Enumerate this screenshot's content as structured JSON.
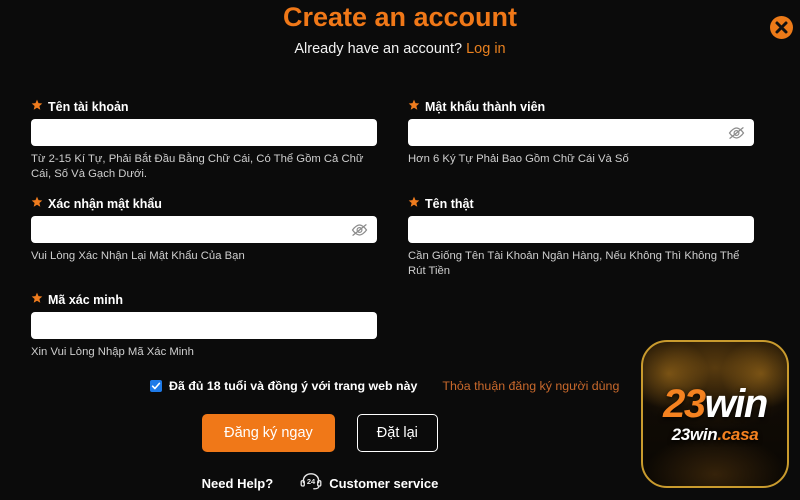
{
  "header": {
    "title": "Create an account",
    "subtitle_prefix": "Already have an account?",
    "login_label": "Log in",
    "close_icon": "close-circle-icon"
  },
  "form": {
    "fields": [
      {
        "id": "username",
        "label": "Tên tài khoản",
        "value": "",
        "placeholder": "",
        "hint": "Từ 2-15 Kí Tự, Phải Bắt Đầu Bằng Chữ Cái, Có Thể Gồm Cả Chữ Cái, Số Và Gạch Dưới.",
        "required_icon": "star-icon",
        "has_eye_toggle": false
      },
      {
        "id": "password",
        "label": "Mật khẩu thành viên",
        "value": "",
        "placeholder": "",
        "hint": "Hơn 6 Ký Tự Phải Bao Gồm Chữ Cái Và Số",
        "required_icon": "star-icon",
        "has_eye_toggle": true,
        "eye_icon": "eye-slash-icon"
      },
      {
        "id": "confirm-password",
        "label": "Xác nhận mật khẩu",
        "value": "",
        "placeholder": "",
        "hint": "Vui Lòng Xác Nhận Lại Mật Khẩu Của Bạn",
        "required_icon": "star-icon",
        "has_eye_toggle": true,
        "eye_icon": "eye-slash-icon"
      },
      {
        "id": "real-name",
        "label": "Tên thật",
        "value": "",
        "placeholder": "",
        "hint": "Cần Giống Tên Tài Khoản Ngân Hàng, Nếu Không Thì Không Thể Rút Tiền",
        "required_icon": "star-icon",
        "has_eye_toggle": false
      },
      {
        "id": "verify-code",
        "label": "Mã xác minh",
        "value": "",
        "placeholder": "",
        "hint": "Xin Vui Lòng Nhập Mã Xác Minh",
        "required_icon": "star-icon",
        "has_eye_toggle": false
      }
    ]
  },
  "agreement": {
    "checked": true,
    "text": "Đã đủ 18 tuổi và đồng ý với trang web này",
    "link_label": "Thỏa thuận đăng ký người dùng"
  },
  "actions": {
    "submit_label": "Đăng ký ngay",
    "reset_label": "Đặt lại"
  },
  "footer": {
    "need_help_label": "Need Help?",
    "customer_service_label": "Customer service",
    "customer_service_icon": "headset-24-icon",
    "headset_badge_text": "24"
  },
  "logo": {
    "main_part1": "23",
    "main_part2": "win",
    "sub_part1": "23win",
    "sub_part2": ".casa"
  },
  "colors": {
    "accent_orange": "#f07818",
    "link_orange": "#c9692c",
    "checkbox_blue": "#1e7ae8",
    "background": "#0b0b0b",
    "logo_gold_border": "#c99b2e"
  }
}
